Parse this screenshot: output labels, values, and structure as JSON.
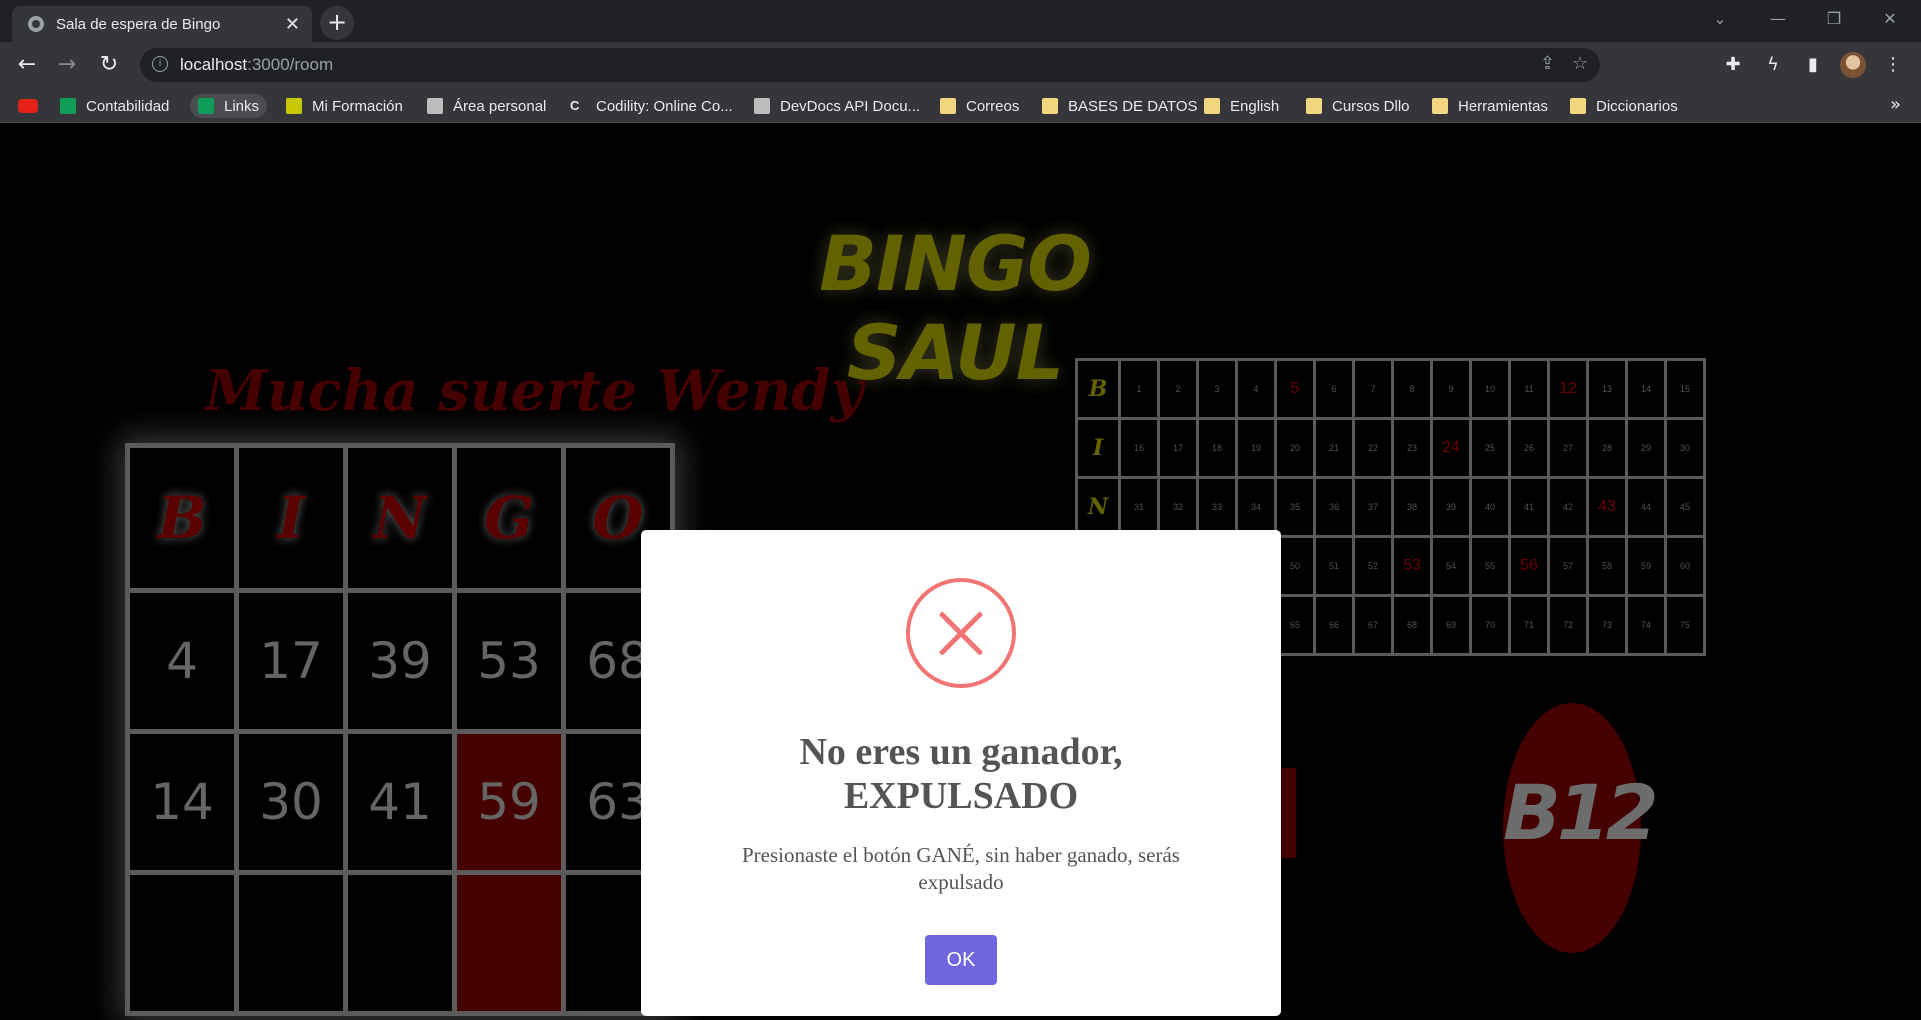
{
  "browser": {
    "tab_title": "Sala de espera de Bingo",
    "tab_close": "✕",
    "new_tab": "+",
    "url_host": "localhost",
    "url_path": ":3000/room",
    "bookmarks": [
      {
        "label": "",
        "icon": "youtube-icon"
      },
      {
        "label": "Contabilidad",
        "icon": "sheets-icon"
      },
      {
        "label": "Links",
        "icon": "sheets-icon"
      },
      {
        "label": "Mi Formación",
        "icon": "shield-icon"
      },
      {
        "label": "Área personal",
        "icon": "page-icon"
      },
      {
        "label": "Codility: Online Co...",
        "icon": "codility-icon"
      },
      {
        "label": "DevDocs API Docu...",
        "icon": "search-icon"
      },
      {
        "label": "Correos",
        "icon": "folder-icon"
      },
      {
        "label": "BASES DE DATOS",
        "icon": "folder-icon"
      },
      {
        "label": "English",
        "icon": "folder-icon"
      },
      {
        "label": "Cursos Dllo",
        "icon": "folder-icon"
      },
      {
        "label": "Herramientas",
        "icon": "folder-icon"
      },
      {
        "label": "Diccionarios",
        "icon": "folder-icon"
      }
    ],
    "overflow": "»"
  },
  "game": {
    "title": "BINGO SAUL",
    "greeting": "Mucha suerte Wendy",
    "board_letters": [
      "B",
      "I",
      "N"
    ],
    "board_rows": [
      [
        "1",
        "2",
        "3",
        "4",
        "5",
        "6",
        "7",
        "8",
        "9",
        "10",
        "11",
        "12",
        "13",
        "14",
        "15"
      ],
      [
        "16",
        "17",
        "18",
        "19",
        "20",
        "21",
        "22",
        "23",
        "24",
        "25",
        "26",
        "27",
        "28",
        "29",
        "30"
      ],
      [
        "31",
        "32",
        "33",
        "34",
        "35",
        "36",
        "37",
        "38",
        "39",
        "40",
        "41",
        "42",
        "43",
        "44",
        "45"
      ],
      [
        "",
        "",
        "",
        "",
        "50",
        "51",
        "52",
        "53",
        "54",
        "55",
        "56",
        "57",
        "58",
        "59",
        "60"
      ],
      [
        "",
        "",
        "",
        "",
        "65",
        "66",
        "67",
        "68",
        "69",
        "70",
        "71",
        "72",
        "73",
        "74",
        "75"
      ]
    ],
    "drawn_numbers": [
      "5",
      "12",
      "24",
      "43",
      "53",
      "56"
    ],
    "card_headers": [
      "B",
      "I",
      "N",
      "G",
      "O"
    ],
    "card_rows": [
      [
        "4",
        "17",
        "39",
        "53",
        "68"
      ],
      [
        "14",
        "30",
        "41",
        "59",
        "63"
      ]
    ],
    "marked_cells": [
      "59"
    ],
    "current_ball": "B12"
  },
  "modal": {
    "title": "No eres un ganador, EXPULSADO",
    "text": "Presionaste el botón GANÉ, sin haber ganado, serás expulsado",
    "ok_label": "OK"
  },
  "colors": {
    "title_yellow": "#9a9600",
    "card_red": "#6b0000",
    "ok_button": "#7066e0",
    "error_icon": "#f27474"
  }
}
